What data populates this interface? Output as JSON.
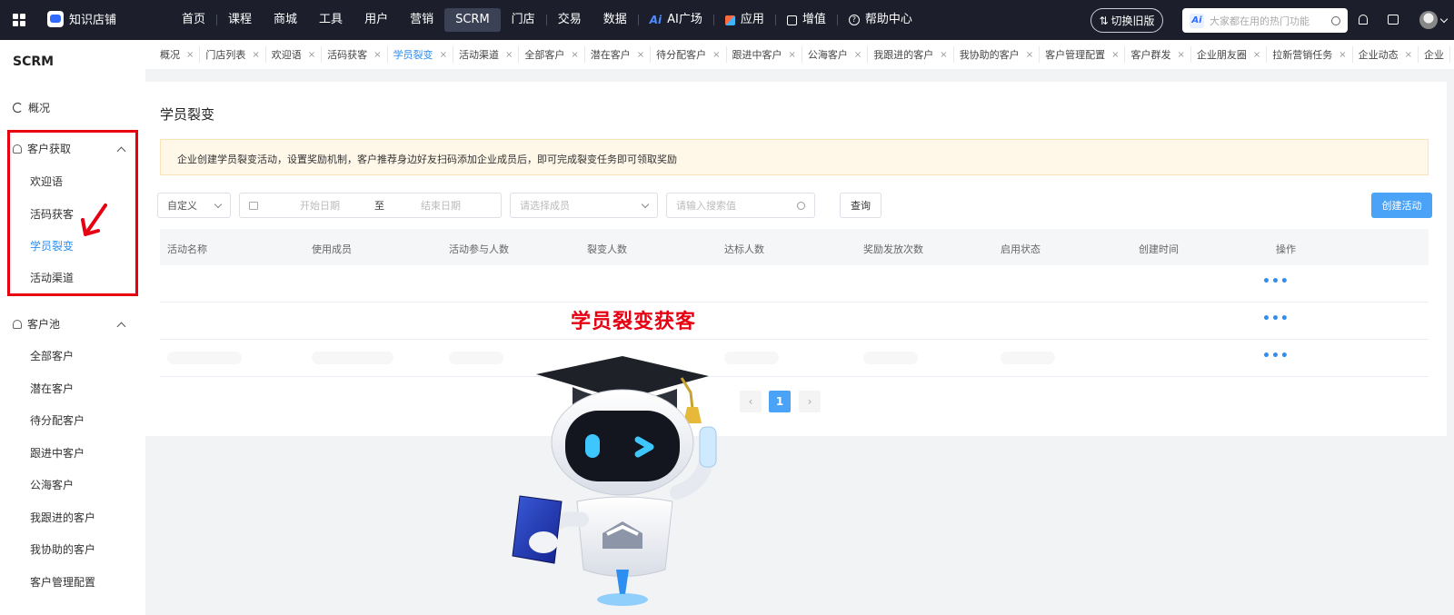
{
  "topbar": {
    "brand": "知识店铺",
    "nav": [
      "首页",
      "课程",
      "商城",
      "工具",
      "用户",
      "营销",
      "SCRM",
      "门店",
      "交易",
      "数据",
      "AI广场",
      "应用",
      "增值",
      "帮助中心"
    ],
    "active_nav": "SCRM",
    "switch_label": "切换旧版",
    "search_placeholder": "大家都在用的热门功能"
  },
  "sidebar": {
    "title": "SCRM",
    "overview": "概况",
    "group1": {
      "label": "客户获取",
      "items": [
        "欢迎语",
        "活码获客",
        "学员裂变",
        "活动渠道"
      ],
      "active": "学员裂变"
    },
    "group2": {
      "label": "客户池",
      "items": [
        "全部客户",
        "潜在客户",
        "待分配客户",
        "跟进中客户",
        "公海客户",
        "我跟进的客户",
        "我协助的客户",
        "客户管理配置"
      ]
    }
  },
  "tabs": [
    "概况",
    "门店列表",
    "欢迎语",
    "活码获客",
    "学员裂变",
    "活动渠道",
    "全部客户",
    "潜在客户",
    "待分配客户",
    "跟进中客户",
    "公海客户",
    "我跟进的客户",
    "我协助的客户",
    "客户管理配置",
    "客户群发",
    "企业朋友圈",
    "拉新营销任务",
    "企业动态",
    "企业"
  ],
  "active_tab": "学员裂变",
  "main": {
    "title": "学员裂变",
    "notice": "企业创建学员裂变活动，设置奖励机制，客户推荐身边好友扫码添加企业成员后，即可完成裂变任务即可领取奖励",
    "filter_type": "自定义",
    "start_placeholder": "开始日期",
    "range_sep": "至",
    "end_placeholder": "结束日期",
    "member_placeholder": "请选择成员",
    "search_placeholder": "请输入搜索值",
    "query_label": "查询",
    "create_label": "创建活动",
    "columns": [
      "活动名称",
      "使用成员",
      "活动参与人数",
      "裂变人数",
      "达标人数",
      "奖励发放次数",
      "启用状态",
      "创建时间",
      "操作"
    ],
    "row_action": "•••",
    "page_current": "1",
    "page_prev": "‹",
    "page_next": "›"
  },
  "overlay": {
    "caption": "学员裂变获客"
  },
  "colors": {
    "accent": "#2e8ff0",
    "highlight": "#e60012",
    "topbar": "#1c1f2b"
  }
}
